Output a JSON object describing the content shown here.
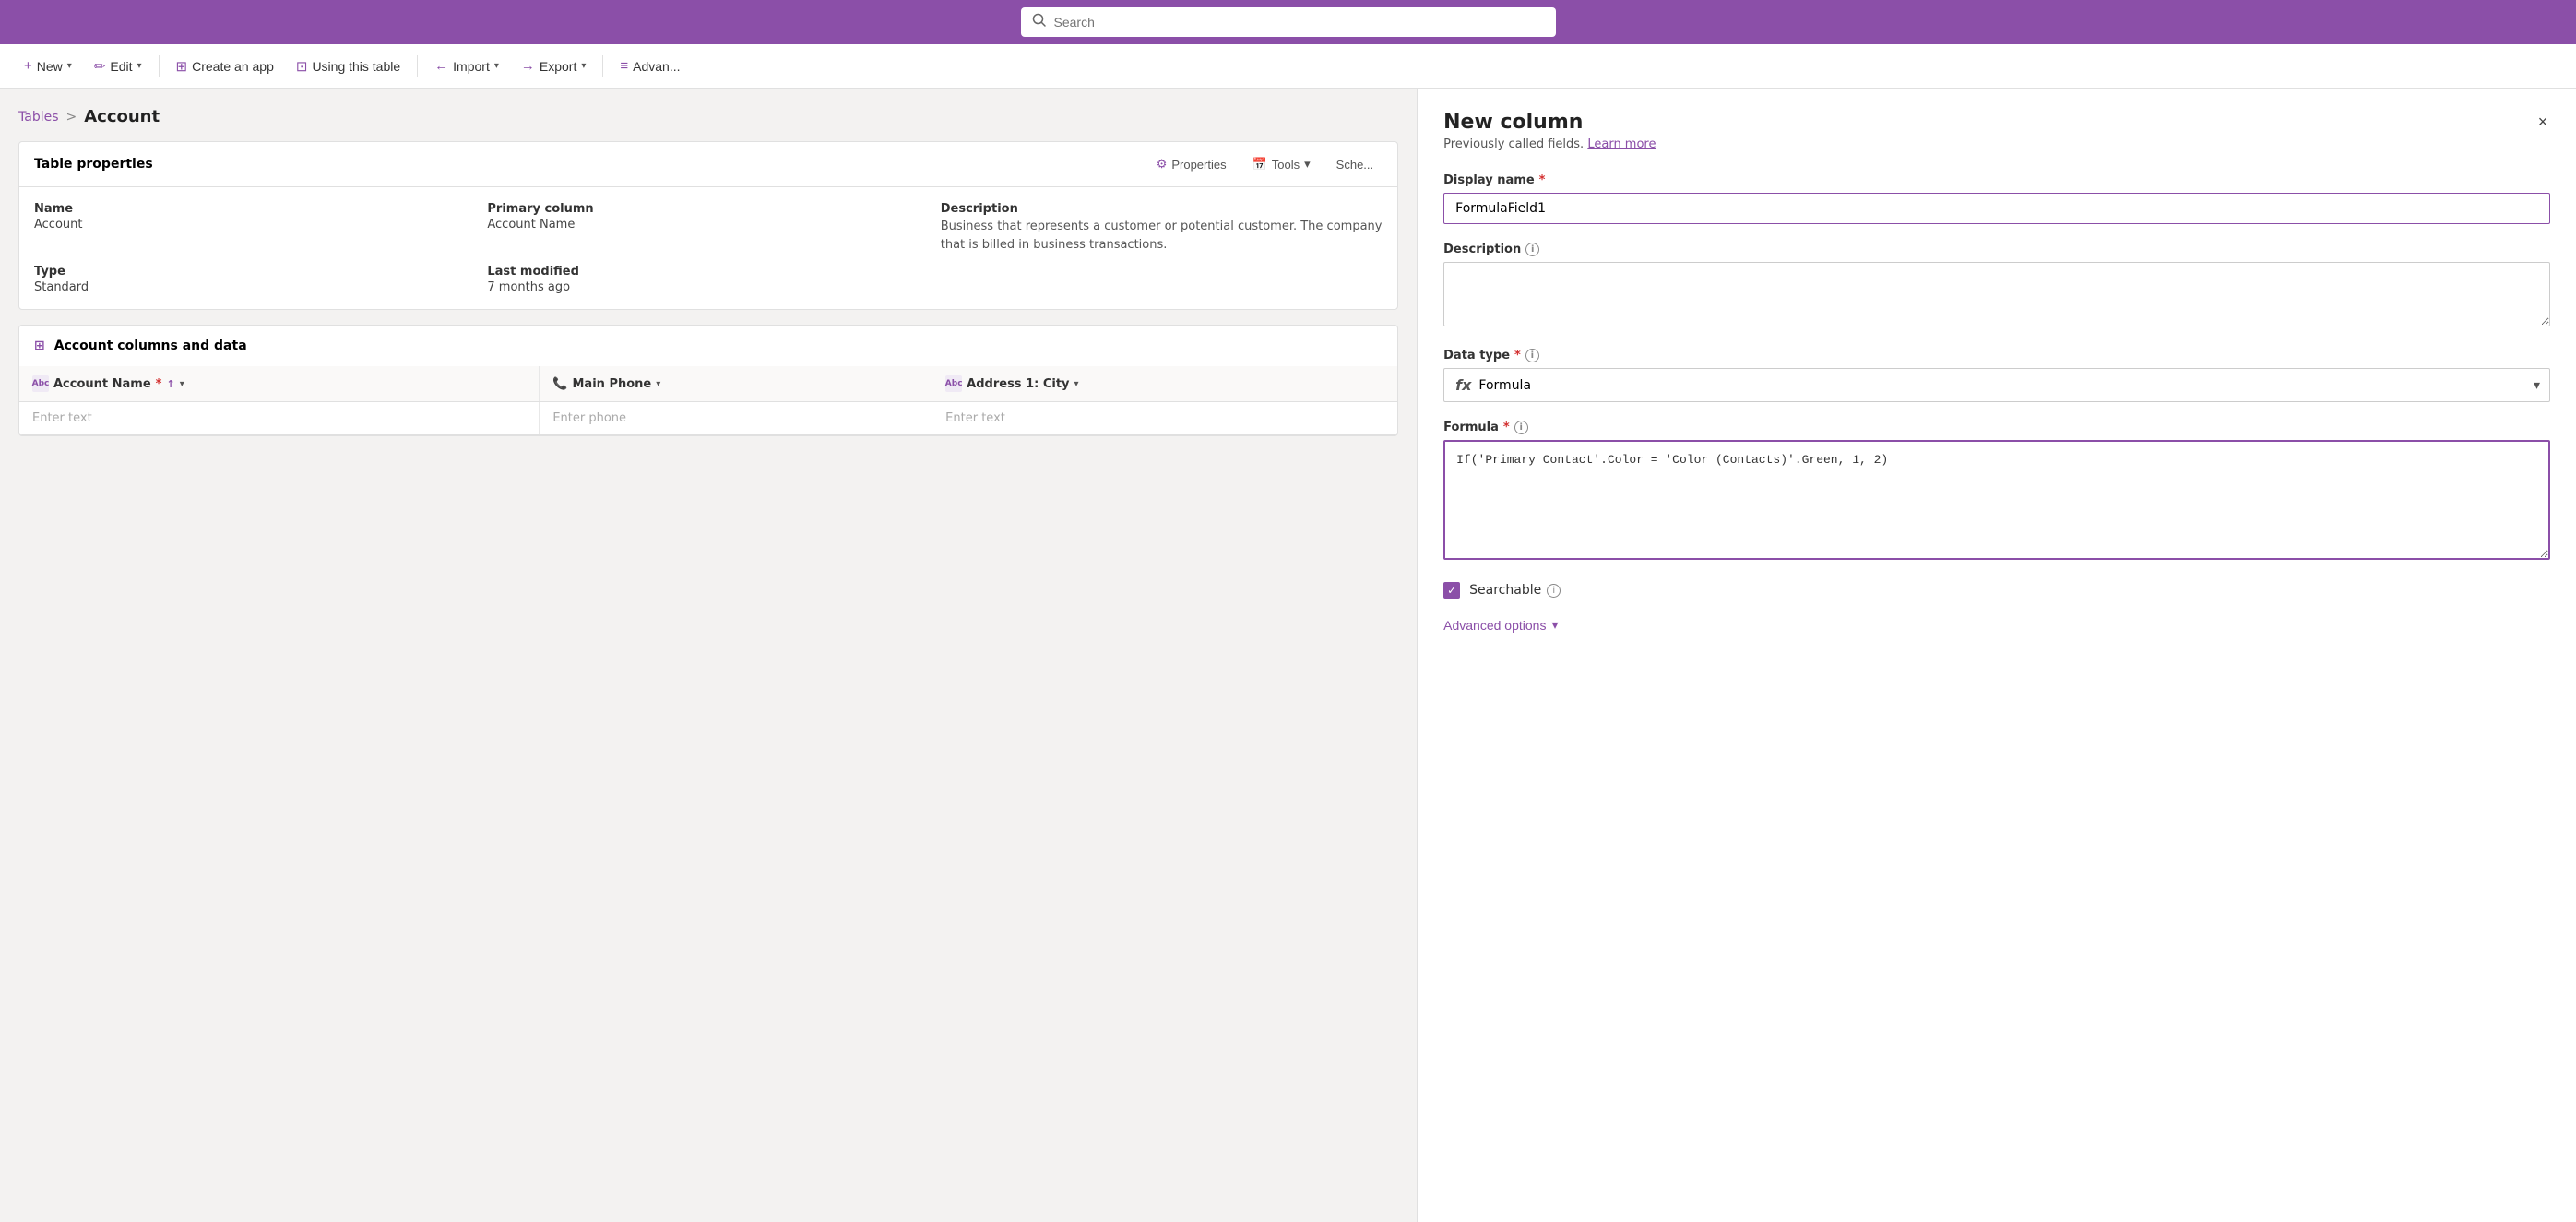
{
  "topbar": {
    "search_placeholder": "Search"
  },
  "toolbar": {
    "new_label": "New",
    "edit_label": "Edit",
    "create_app_label": "Create an app",
    "using_table_label": "Using this table",
    "import_label": "Import",
    "export_label": "Export",
    "advan_label": "Advan..."
  },
  "breadcrumb": {
    "tables_label": "Tables",
    "separator": ">",
    "current": "Account"
  },
  "table_properties": {
    "title": "Table properties",
    "properties_btn": "Properties",
    "tools_btn": "Tools",
    "schedule_btn": "Sche...",
    "name_label": "Name",
    "name_value": "Account",
    "type_label": "Type",
    "type_value": "Standard",
    "primary_col_label": "Primary column",
    "primary_col_value": "Account Name",
    "last_modified_label": "Last modified",
    "last_modified_value": "7 months ago",
    "description_label": "Description",
    "description_value": "Business that represents a customer or potential customer. The company that is billed in business transactions."
  },
  "columns_section": {
    "title": "Account columns and data",
    "columns": [
      {
        "icon": "Abc",
        "name": "Account Name",
        "required": true,
        "sortable": true,
        "has_dropdown": true
      },
      {
        "icon": "phone",
        "name": "Main Phone",
        "required": false,
        "sortable": false,
        "has_dropdown": true
      },
      {
        "icon": "Abc",
        "name": "Address 1: City",
        "required": false,
        "sortable": false,
        "has_dropdown": true
      }
    ],
    "enter_text": "Enter text",
    "enter_phone": "Enter phone",
    "enter_text2": "Enter text"
  },
  "new_column_panel": {
    "title": "New column",
    "subtitle": "Previously called fields.",
    "learn_more": "Learn more",
    "display_name_label": "Display name",
    "display_name_required": "*",
    "display_name_value": "FormulaField1",
    "description_label": "Description",
    "description_info": "i",
    "description_placeholder": "",
    "data_type_label": "Data type",
    "data_type_required": "*",
    "data_type_info": "i",
    "data_type_value": "Formula",
    "formula_label": "Formula",
    "formula_required": "*",
    "formula_info": "i",
    "formula_value": "If('Primary Contact'.Color = 'Color (Contacts)'.Green, 1, 2)",
    "searchable_label": "Searchable",
    "searchable_info": "i",
    "advanced_options_label": "Advanced options",
    "close_icon": "×"
  }
}
